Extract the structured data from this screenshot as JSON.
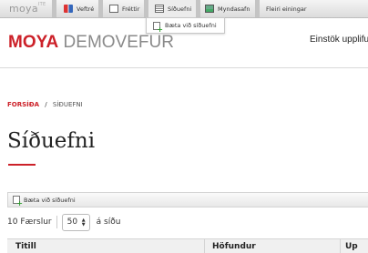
{
  "admin_bar": {
    "logo_text": "moya",
    "logo_sup": "ITE",
    "items": [
      {
        "label": "Veftré",
        "icon": "sitemap-icon"
      },
      {
        "label": "Fréttir",
        "icon": "news-icon"
      },
      {
        "label": "Síðuefni",
        "icon": "page-icon"
      },
      {
        "label": "Myndasafn",
        "icon": "image-gallery-icon"
      },
      {
        "label": "Fleiri einingar",
        "icon": ""
      }
    ],
    "dropdown_item": {
      "label": "Bæta við síðuefni",
      "icon": "add-page-icon"
    }
  },
  "header": {
    "brand_bold": "MOYA",
    "brand_light": "DEMOVEFUR",
    "tagline": "Einstök upplifun"
  },
  "breadcrumb": {
    "home": "FORSÍÐA",
    "separator": "/",
    "current": "SÍÐUEFNI"
  },
  "page": {
    "title": "Síðuefni",
    "add_button": "Bæta við síðuefni"
  },
  "listing": {
    "records_text": "10 Færslur",
    "per_page_value": "50",
    "per_page_suffix": "á síðu",
    "columns": [
      "Titill",
      "Höfundur",
      "Up"
    ]
  },
  "colors": {
    "accent": "#cc2129",
    "brand_gray": "#8a8a8a"
  }
}
